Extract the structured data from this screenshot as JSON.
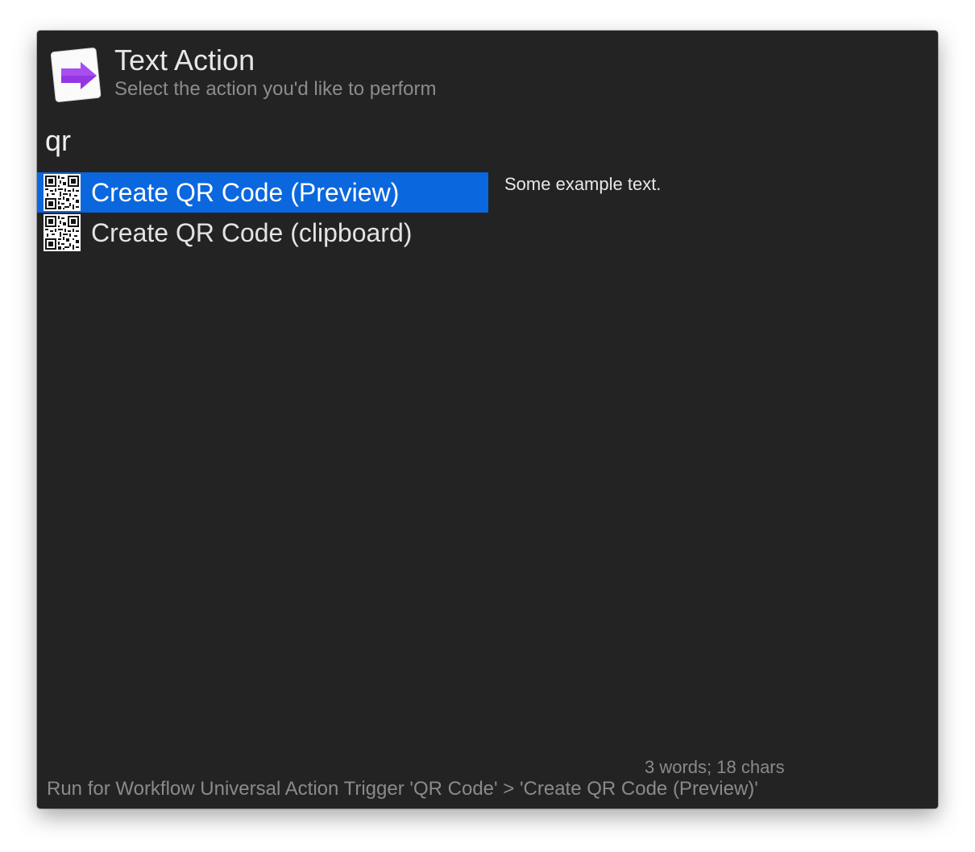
{
  "header": {
    "title": "Text Action",
    "subtitle": "Select the action you'd like to perform",
    "icon": "text-action-arrow-icon",
    "arrow_color": "#8a2be2"
  },
  "search": {
    "value": "qr"
  },
  "results": [
    {
      "label": "Create QR Code (Preview)",
      "icon": "qr-code-icon",
      "selected": true
    },
    {
      "label": "Create QR Code (clipboard)",
      "icon": "qr-code-icon",
      "selected": false
    }
  ],
  "preview": {
    "text": "Some example text."
  },
  "stats": {
    "text": "3 words; 18 chars"
  },
  "footer": {
    "text": "Run for Workflow Universal Action Trigger 'QR Code' > 'Create QR Code (Preview)'"
  },
  "colors": {
    "window_background": "#232323",
    "selection": "#0a67de",
    "secondary_text": "#8a8a8a"
  }
}
